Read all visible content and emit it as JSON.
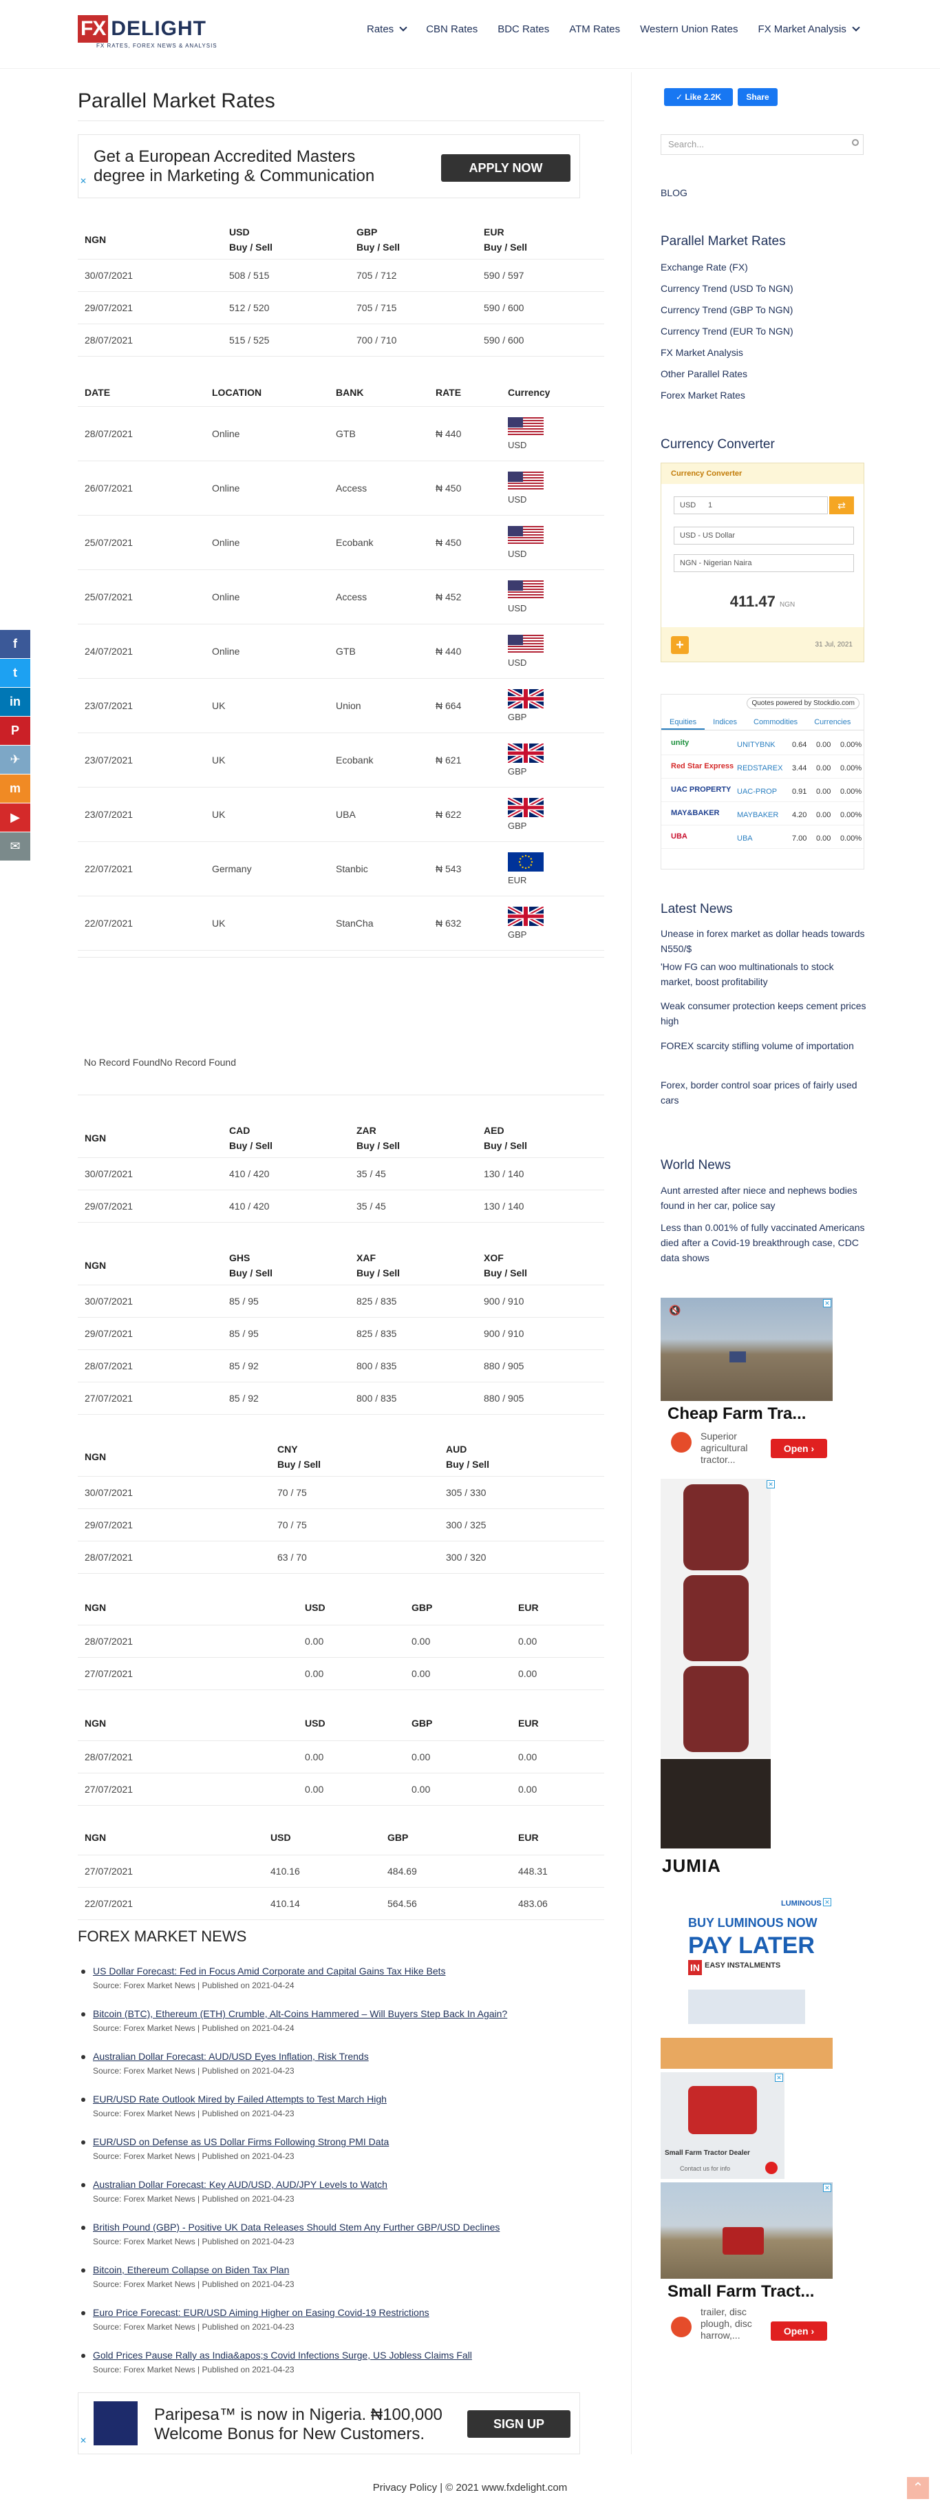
{
  "site": {
    "logo_fx": "FX",
    "logo_delight": "DELIGHT",
    "logo_tagline": "FX RATES, FOREX NEWS & ANALYSIS"
  },
  "nav": {
    "items": [
      "Rates",
      "CBN Rates",
      "BDC Rates",
      "ATM Rates",
      "Western Union Rates",
      "FX Market Analysis"
    ]
  },
  "page_title": "Parallel Market Rates",
  "ad_top": {
    "line1": "Get a European Accredited Masters",
    "line2": "degree in Marketing & Communication",
    "button": "APPLY NOW"
  },
  "table1": {
    "headers": [
      [
        "NGN",
        ""
      ],
      [
        "USD",
        "Buy / Sell"
      ],
      [
        "GBP",
        "Buy / Sell"
      ],
      [
        "EUR",
        "Buy / Sell"
      ]
    ],
    "rows": [
      [
        "30/07/2021",
        "508 / 515",
        "705 / 712",
        "590 / 597"
      ],
      [
        "29/07/2021",
        "512 / 520",
        "705 / 715",
        "590 / 600"
      ],
      [
        "28/07/2021",
        "515 / 525",
        "700 / 710",
        "590 / 600"
      ]
    ]
  },
  "table2": {
    "headers": [
      "DATE",
      "LOCATION",
      "BANK",
      "RATE",
      "Currency"
    ],
    "rows": [
      [
        "28/07/2021",
        "Online",
        "GTB",
        "₦ 440",
        "USD"
      ],
      [
        "26/07/2021",
        "Online",
        "Access",
        "₦ 450",
        "USD"
      ],
      [
        "25/07/2021",
        "Online",
        "Ecobank",
        "₦ 450",
        "USD"
      ],
      [
        "25/07/2021",
        "Online",
        "Access",
        "₦ 452",
        "USD"
      ],
      [
        "24/07/2021",
        "Online",
        "GTB",
        "₦ 440",
        "USD"
      ],
      [
        "23/07/2021",
        "UK",
        "Union",
        "₦ 664",
        "GBP"
      ],
      [
        "23/07/2021",
        "UK",
        "Ecobank",
        "₦ 621",
        "GBP"
      ],
      [
        "23/07/2021",
        "UK",
        "UBA",
        "₦ 622",
        "GBP"
      ],
      [
        "22/07/2021",
        "Germany",
        "Stanbic",
        "₦ 543",
        "EUR"
      ],
      [
        "22/07/2021",
        "UK",
        "StanCha",
        "₦ 632",
        "GBP"
      ]
    ]
  },
  "no_record": "No Record FoundNo Record Found",
  "table3": {
    "headers": [
      [
        "NGN",
        ""
      ],
      [
        "CAD",
        "Buy / Sell"
      ],
      [
        "ZAR",
        "Buy / Sell"
      ],
      [
        "AED",
        "Buy / Sell"
      ]
    ],
    "rows": [
      [
        "30/07/2021",
        "410 / 420",
        "35 / 45",
        "130 / 140"
      ],
      [
        "29/07/2021",
        "410 / 420",
        "35 / 45",
        "130 / 140"
      ]
    ]
  },
  "table4": {
    "headers": [
      [
        "NGN",
        ""
      ],
      [
        "GHS",
        "Buy / Sell"
      ],
      [
        "XAF",
        "Buy / Sell"
      ],
      [
        "XOF",
        "Buy / Sell"
      ]
    ],
    "rows": [
      [
        "30/07/2021",
        "85 / 95",
        "825 / 835",
        "900 / 910"
      ],
      [
        "29/07/2021",
        "85 / 95",
        "825 / 835",
        "900 / 910"
      ],
      [
        "28/07/2021",
        "85 / 92",
        "800 / 835",
        "880 / 905"
      ],
      [
        "27/07/2021",
        "85 / 92",
        "800 / 835",
        "880 / 905"
      ]
    ]
  },
  "table5": {
    "headers": [
      [
        "NGN",
        ""
      ],
      [
        "CNY",
        "Buy / Sell"
      ],
      [
        "AUD",
        "Buy / Sell"
      ]
    ],
    "rows": [
      [
        "30/07/2021",
        "70 / 75",
        "305 / 330"
      ],
      [
        "29/07/2021",
        "70 / 75",
        "300 / 325"
      ],
      [
        "28/07/2021",
        "63 / 70",
        "300 / 320"
      ]
    ]
  },
  "table6": {
    "headers": [
      "NGN",
      "USD",
      "GBP",
      "EUR"
    ],
    "rows": [
      [
        "28/07/2021",
        "0.00",
        "0.00",
        "0.00"
      ],
      [
        "27/07/2021",
        "0.00",
        "0.00",
        "0.00"
      ]
    ]
  },
  "table7": {
    "headers": [
      "NGN",
      "USD",
      "GBP",
      "EUR"
    ],
    "rows": [
      [
        "28/07/2021",
        "0.00",
        "0.00",
        "0.00"
      ],
      [
        "27/07/2021",
        "0.00",
        "0.00",
        "0.00"
      ]
    ]
  },
  "table8": {
    "headers": [
      "NGN",
      "USD",
      "GBP",
      "EUR"
    ],
    "rows": [
      [
        "27/07/2021",
        "410.16",
        "484.69",
        "448.31"
      ],
      [
        "22/07/2021",
        "410.14",
        "564.56",
        "483.06"
      ]
    ]
  },
  "forex_news": {
    "title": "FOREX MARKET NEWS",
    "items": [
      {
        "title": "US Dollar Forecast: Fed in Focus Amid Corporate and Capital Gains Tax Hike Bets",
        "source": "Source: Forex Market News | Published on 2021-04-24"
      },
      {
        "title": "Bitcoin (BTC), Ethereum (ETH) Crumble, Alt-Coins Hammered – Will Buyers Step Back In Again?",
        "source": "Source: Forex Market News | Published on 2021-04-24"
      },
      {
        "title": "Australian Dollar Forecast: AUD/USD Eyes Inflation, Risk Trends",
        "source": "Source: Forex Market News | Published on 2021-04-23"
      },
      {
        "title": "EUR/USD Rate Outlook Mired by Failed Attempts to Test March High",
        "source": "Source: Forex Market News | Published on 2021-04-23"
      },
      {
        "title": "EUR/USD on Defense as US Dollar Firms Following Strong PMI Data",
        "source": "Source: Forex Market News | Published on 2021-04-23"
      },
      {
        "title": "Australian Dollar Forecast: Key AUD/USD, AUD/JPY Levels to Watch",
        "source": "Source: Forex Market News | Published on 2021-04-23"
      },
      {
        "title": "British Pound (GBP) - Positive UK Data Releases Should Stem Any Further GBP/USD Declines",
        "source": "Source: Forex Market News | Published on 2021-04-23"
      },
      {
        "title": "Bitcoin, Ethereum Collapse on Biden Tax Plan",
        "source": "Source: Forex Market News | Published on 2021-04-23"
      },
      {
        "title": "Euro Price Forecast: EUR/USD Aiming Higher on Easing Covid-19 Restrictions",
        "source": "Source: Forex Market News | Published on 2021-04-23"
      },
      {
        "title": "Gold Prices Pause Rally as India&apos;s Covid Infections Surge, US Jobless Claims Fall",
        "source": "Source: Forex Market News | Published on 2021-04-23"
      }
    ]
  },
  "ad_bottom": {
    "line1": "Paripesa™ is now in Nigeria. ₦100,000",
    "line2": "Welcome Bonus for New Customers.",
    "button": "SIGN UP"
  },
  "footer": "Privacy Policy | © 2021 www.fxdelight.com",
  "sidebar": {
    "fb_like": "✓ Like 2.2K",
    "fb_share": "Share",
    "search_placeholder": "Search...",
    "blog": "BLOG",
    "pmr_title": "Parallel Market Rates",
    "pmr_links": [
      "Exchange Rate (FX)",
      "Currency Trend (USD To NGN)",
      "Currency Trend (GBP To NGN)",
      "Currency Trend (EUR To NGN)",
      "FX Market Analysis",
      "Other Parallel Rates",
      "Forex Market Rates"
    ],
    "cc_title": "Currency Converter",
    "cc": {
      "header": "Currency Converter",
      "code": "USD",
      "amount": "1",
      "from": "USD - US Dollar",
      "to": "NGN - Nigerian Naira",
      "result": "411.47",
      "result_unit": "NGN",
      "date": "31 Jul, 2021"
    },
    "stocks": {
      "powered": "Quotes powered by Stockdio.com",
      "tabs": [
        "Equities",
        "Indices",
        "Commodities",
        "Currencies"
      ],
      "rows": [
        [
          "unity",
          "UNITYBNK",
          "0.64",
          "0.00",
          "0.00%"
        ],
        [
          "Red Star Express",
          "REDSTAREX",
          "3.44",
          "0.00",
          "0.00%"
        ],
        [
          "UAC PROPERTY",
          "UAC-PROP",
          "0.91",
          "0.00",
          "0.00%"
        ],
        [
          "MAY&BAKER",
          "MAYBAKER",
          "4.20",
          "0.00",
          "0.00%"
        ],
        [
          "UBA",
          "UBA",
          "7.00",
          "0.00",
          "0.00%"
        ]
      ]
    },
    "latest_news_title": "Latest News",
    "latest_news": [
      "Unease in forex market as dollar heads towards N550/$",
      "'How FG can woo multinationals to stock market, boost profitability",
      "Weak consumer protection keeps cement prices high",
      "FOREX scarcity stifling volume of importation",
      "Forex, border control soar prices of fairly used cars"
    ],
    "world_news_title": "World News",
    "world_news": [
      "Aunt arrested after niece and nephews bodies found in her car, police say",
      "Less than 0.001% of fully vaccinated Americans died after a Covid-19 breakthrough case, CDC data shows"
    ],
    "ad1": {
      "title": "Cheap Farm Tra...",
      "text": "Superior agricultural tractor...",
      "button": "Open ›"
    },
    "ad_jumia": "JUMIA",
    "ad_luminous": {
      "brand": "LUMINOUS",
      "l1": "BUY LUMINOUS NOW",
      "l2": "PAY LATER",
      "l3": "IN",
      "l4": "EASY INSTALMENTS"
    },
    "ad2": {
      "title": "Small Farm Tractor Dealer",
      "text": "Contact us for info"
    },
    "ad3": {
      "title": "Small Farm Tract...",
      "text": "trailer, disc plough, disc harrow,...",
      "button": "Open ›"
    }
  },
  "share_bar": [
    {
      "icon": "facebook-icon",
      "label": "f",
      "color": "#3b5998"
    },
    {
      "icon": "twitter-icon",
      "label": "t",
      "color": "#1da1f2"
    },
    {
      "icon": "linkedin-icon",
      "label": "in",
      "color": "#0077b5"
    },
    {
      "icon": "pinterest-icon",
      "label": "P",
      "color": "#cb2027"
    },
    {
      "icon": "telegram-icon",
      "label": "✈",
      "color": "#7da7c6"
    },
    {
      "icon": "mix-icon",
      "label": "m",
      "color": "#f08a24"
    },
    {
      "icon": "youtube-icon",
      "label": "▶",
      "color": "#d42a2a"
    },
    {
      "icon": "email-icon",
      "label": "✉",
      "color": "#7b8a8b"
    }
  ]
}
